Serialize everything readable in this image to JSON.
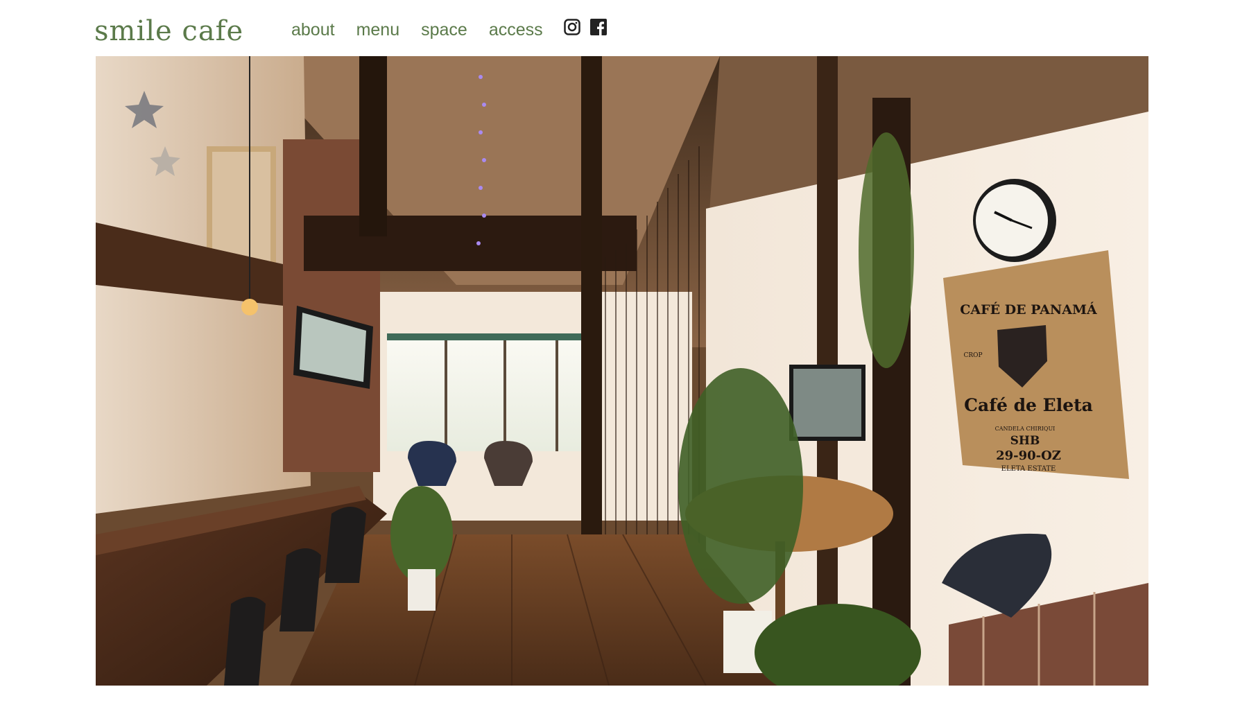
{
  "site": {
    "logo_text": "smile cafe"
  },
  "nav": {
    "items": [
      {
        "label": "about"
      },
      {
        "label": "menu"
      },
      {
        "label": "space"
      },
      {
        "label": "access"
      }
    ],
    "social": [
      {
        "icon": "instagram-icon"
      },
      {
        "icon": "facebook-icon"
      }
    ]
  },
  "hero": {
    "sack_text": {
      "line1": "CAFÉ DE PANAMÁ",
      "crop": "CROP",
      "line2": "Café de Eleta",
      "small": "CANDELA CHIRIQUI",
      "shb": "SHB",
      "code": "29-90-OZ",
      "estate": "ELETA ESTATE"
    }
  },
  "colors": {
    "nav_text": "#5b7a4a",
    "background": "#ffffff"
  }
}
